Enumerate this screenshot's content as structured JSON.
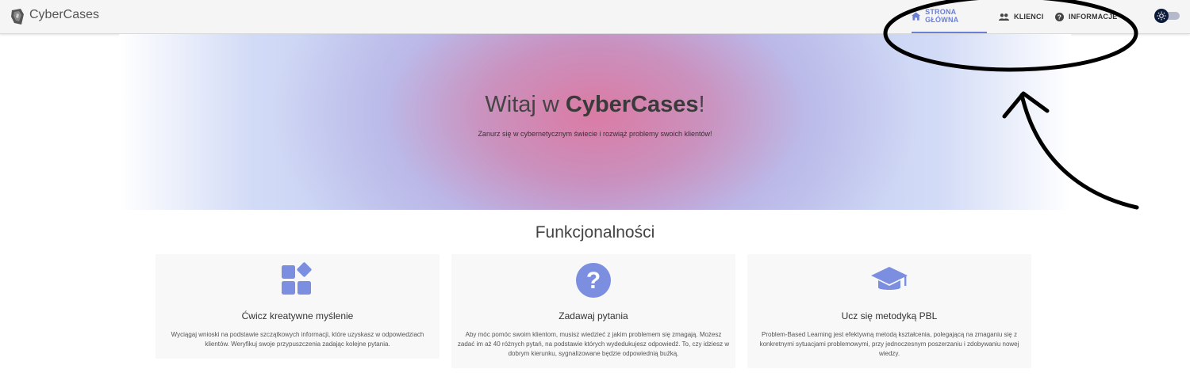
{
  "app": {
    "brand": "CyberCases"
  },
  "nav": {
    "items": [
      {
        "label": "STRONA GŁÓWNA",
        "icon": "home-icon",
        "active": true
      },
      {
        "label": "KLIENCI",
        "icon": "people-icon",
        "active": false
      },
      {
        "label": "INFORMACJE",
        "icon": "help-circle-icon",
        "active": false
      }
    ],
    "theme_toggle_icon": "sun-icon"
  },
  "hero": {
    "title_prefix": "Witaj w ",
    "title_brand": "CyberCases",
    "title_suffix": "!",
    "subtitle": "Zanurz się w cybernetycznym świecie i rozwiąż problemy swoich klientów!"
  },
  "features": {
    "heading": "Funkcjonalności",
    "cards": [
      {
        "icon": "widgets-icon",
        "title": "Ćwicz kreatywne myślenie",
        "text": "Wyciągaj wnioski na podstawie szczątkowych informacji, które uzyskasz w odpowiedziach klientów. Weryfikuj swoje przypuszczenia zadając kolejne pytania."
      },
      {
        "icon": "question-icon",
        "title": "Zadawaj pytania",
        "text": "Aby móc pomóc swoim klientom, musisz wiedzieć z jakim problemem się zmagają. Możesz zadać im aż 40 różnych pytań, na podstawie których wydedukujesz odpowiedź. To, czy idziesz w dobrym kierunku, sygnalizowane będzie odpowiednią buźką."
      },
      {
        "icon": "graduation-cap-icon",
        "title": "Ucz się metodyką PBL",
        "text": "Problem-Based Learning jest efektywną metodą kształcenia, polegającą na zmaganiu się z konkretnymi sytuacjami problemowymi, przy jednoczesnym poszerzaniu i zdobywaniu nowej wiedzy."
      }
    ]
  },
  "colors": {
    "accent": "#6b7fd7",
    "icon": "#7b8ee0",
    "appbar": "#f5f5f5",
    "card": "#f8f8f8"
  }
}
